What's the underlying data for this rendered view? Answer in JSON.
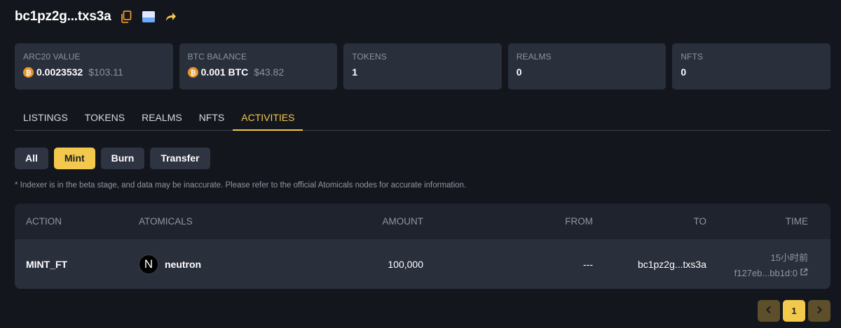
{
  "header": {
    "address": "bc1pz2g...txs3a",
    "icons": [
      "copy-icon",
      "wallet-icon",
      "share-arrow-icon"
    ]
  },
  "stats": [
    {
      "label": "ARC20 VALUE",
      "value": "0.0023532",
      "sub": "$103.11",
      "icon": "bitcoin-icon"
    },
    {
      "label": "BTC BALANCE",
      "value": "0.001 BTC",
      "sub": "$43.82",
      "icon": "bitcoin-icon"
    },
    {
      "label": "TOKENS",
      "value": "1"
    },
    {
      "label": "REALMS",
      "value": "0"
    },
    {
      "label": "NFTS",
      "value": "0"
    }
  ],
  "tabs": [
    "LISTINGS",
    "TOKENS",
    "REALMS",
    "NFTS",
    "ACTIVITIES"
  ],
  "active_tab": "ACTIVITIES",
  "filters": [
    "All",
    "Mint",
    "Burn",
    "Transfer"
  ],
  "active_filter": "Mint",
  "note": "* Indexer is in the beta stage, and data may be inaccurate. Please refer to the official Atomicals nodes for accurate information.",
  "table": {
    "columns": [
      "ACTION",
      "ATOMICALS",
      "AMOUNT",
      "FROM",
      "TO",
      "TIME"
    ],
    "rows": [
      {
        "action": "MINT_FT",
        "atomical": "neutron",
        "atomical_logo": "N",
        "amount": "100,000",
        "from": "---",
        "to": "bc1pz2g...txs3a",
        "time": "15小时前",
        "tx": "f127eb...bb1d:0"
      }
    ]
  },
  "pagination": {
    "current": "1"
  },
  "colors": {
    "background": "#14161d",
    "card": "#2a2f3c",
    "accent": "#f2c94c",
    "bitcoin": "#e8952c"
  }
}
